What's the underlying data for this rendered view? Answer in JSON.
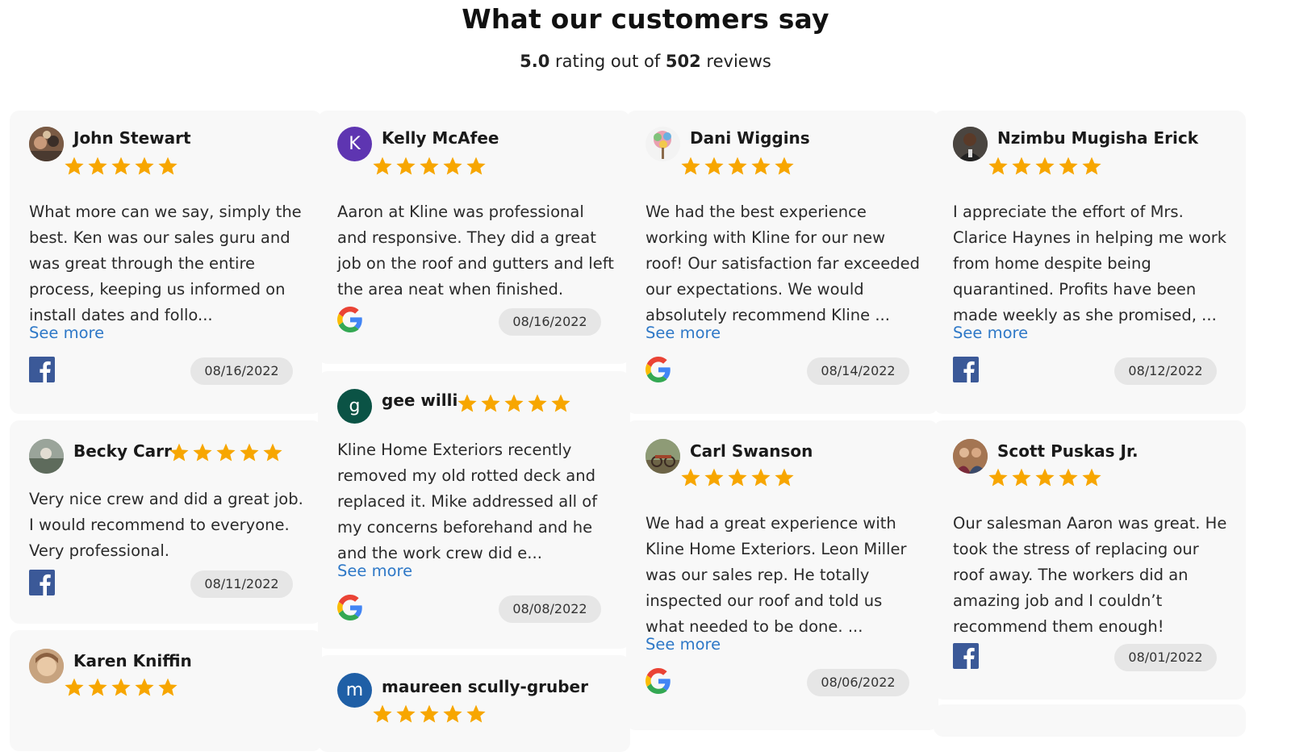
{
  "header": {
    "title": "What our customers say",
    "rating": "5.0",
    "rating_mid": " rating out of ",
    "review_count": "502",
    "rating_suffix": " reviews"
  },
  "colors": {
    "star": "#f7a600",
    "link": "#2e78c7",
    "card_bg": "#f8f8f8",
    "date_bg": "#e6e6e6",
    "facebook": "#3b5998"
  },
  "reviews": [
    {
      "name": "John Stewart",
      "rating": 5,
      "text": "What more can we say, simply the best. Ken was our sales guru and was great through the entire process, keeping us informed on install dates and follo...",
      "see_more": "See more",
      "source": "facebook-icon",
      "date": "08/16/2022"
    },
    {
      "name": "Becky Carr",
      "rating": 5,
      "text": "Very nice crew and did a great job. I would recommend to everyone. Very professional.",
      "source": "facebook-icon",
      "date": "08/11/2022"
    },
    {
      "name": "Karen Kniffin",
      "rating": 5
    },
    {
      "name": "Kelly McAfee",
      "initial": "K",
      "rating": 5,
      "text": "Aaron at Kline was professional and responsive. They did a great job on the roof and gutters and left the area neat when finished.",
      "source": "google-icon",
      "date": "08/16/2022"
    },
    {
      "name": "gee willi",
      "initial": "g",
      "rating": 5,
      "text": "Kline Home Exteriors recently removed my old rotted deck and replaced it. Mike addressed all of my concerns beforehand and he and the work crew did e...",
      "see_more": "See more",
      "source": "google-icon",
      "date": "08/08/2022"
    },
    {
      "name": "maureen scully-gruber",
      "initial": "m",
      "rating": 5
    },
    {
      "name": "Dani Wiggins",
      "rating": 5,
      "text": "We had the best experience working with Kline for our new roof! Our satisfaction far exceeded our expectations. We would absolutely recommend Kline ...",
      "see_more": "See more",
      "source": "google-icon",
      "date": "08/14/2022"
    },
    {
      "name": "Carl Swanson",
      "rating": 5,
      "text": "We had a great experience with Kline Home Exteriors. Leon Miller was our sales rep. He totally inspected our roof and told us what needed to be done. ...",
      "see_more": "See more",
      "source": "google-icon",
      "date": "08/06/2022"
    },
    {
      "name": "Nzimbu Mugisha Erick",
      "rating": 5,
      "text": "I appreciate the effort of Mrs. Clarice Haynes in helping me work from home despite being quarantined. Profits have been made weekly as she promised, ...",
      "see_more": "See more",
      "source": "facebook-icon",
      "date": "08/12/2022"
    },
    {
      "name": "Scott Puskas Jr.",
      "rating": 5,
      "text": "Our salesman Aaron was great. He took the stress of replacing our roof away. The workers did an amazing job and I couldn’t recommend them enough!",
      "source": "facebook-icon",
      "date": "08/01/2022"
    }
  ]
}
